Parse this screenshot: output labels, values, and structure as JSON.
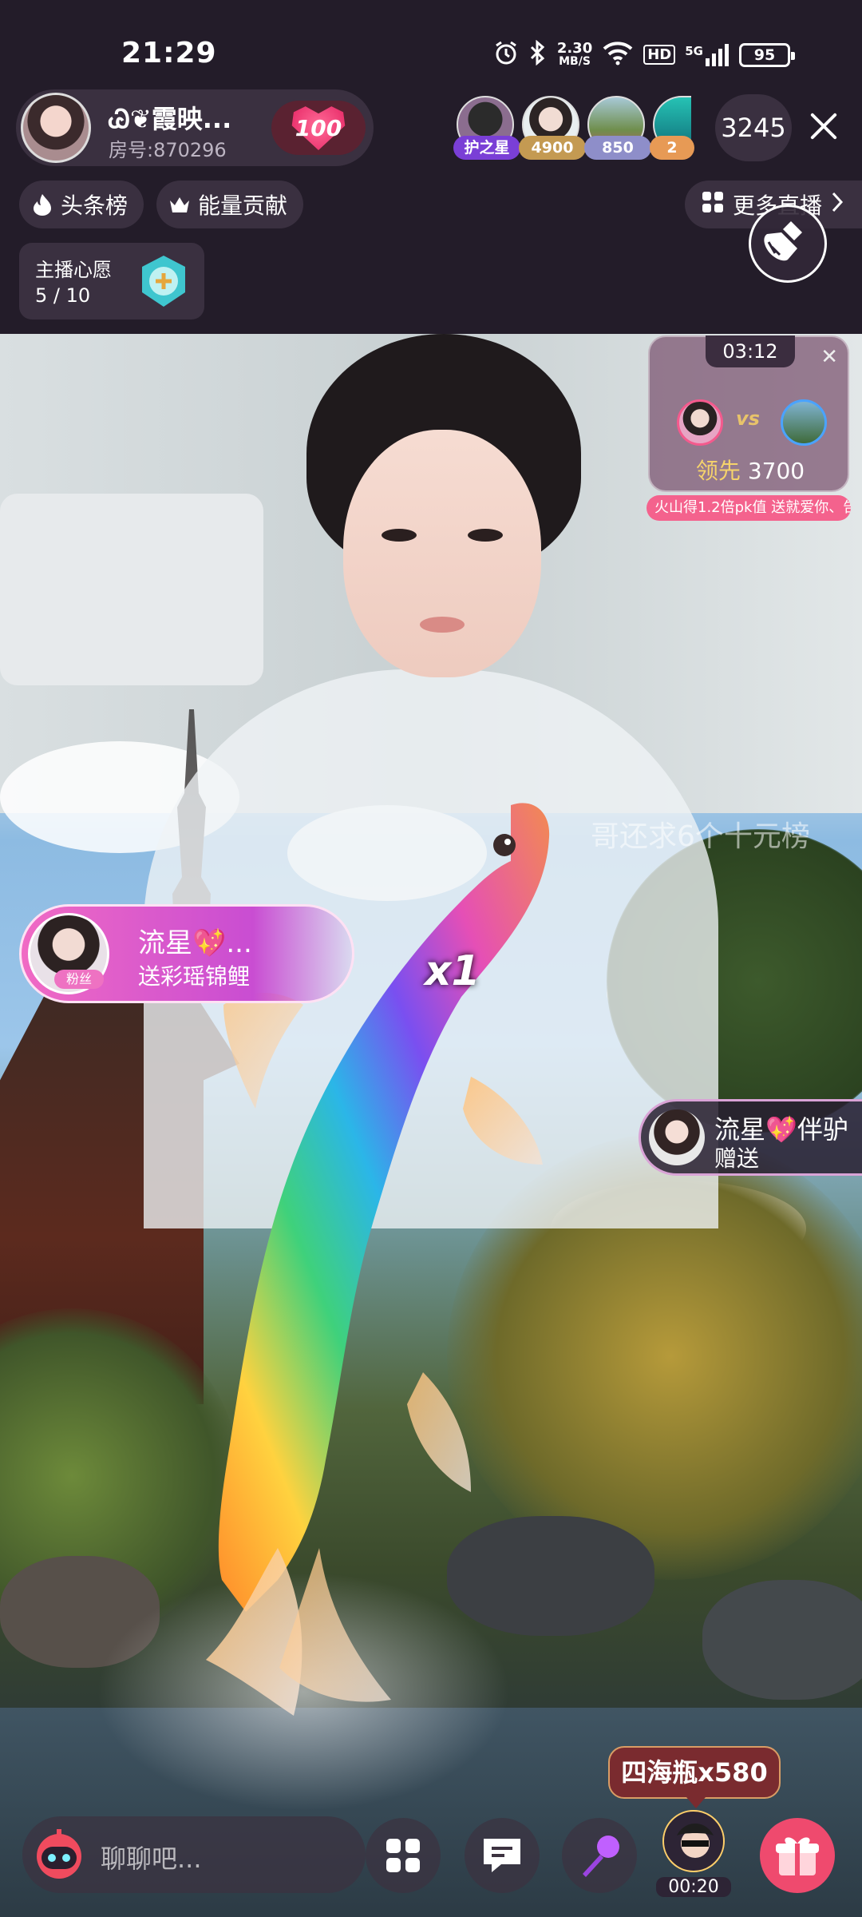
{
  "status_bar": {
    "time": "21:29",
    "net_speed_value": "2.30",
    "net_speed_unit": "MB/S",
    "hd": "HD",
    "network": "5G",
    "battery": "95"
  },
  "header": {
    "host_name": "Ꮚ❦霞映...",
    "room_number": "房号:870296",
    "heart_level": "100",
    "viewers": [
      {
        "tag": "护之星",
        "tag_color": "#7a3fd6"
      },
      {
        "tag": "4900",
        "tag_color": "#c49a52"
      },
      {
        "tag": "850",
        "tag_color": "#8e8ec9"
      },
      {
        "tag": "2",
        "tag_color": "#e79a55"
      }
    ],
    "online_count": "3245",
    "chips": {
      "headline_rank": "头条榜",
      "energy_contribution": "能量贡献",
      "more_live": "更多直播"
    },
    "wish": {
      "title": "主播心愿",
      "progress": "5 / 10",
      "progress_value": 0.5
    }
  },
  "pk": {
    "timer": "03:12",
    "vs": "vs",
    "lead_label": "领先",
    "lead_value": "3700",
    "strip_text": "火山得1.2倍pk值    送就爱你、告"
  },
  "overlay_banner": "哥还求6个十元榜",
  "gift_notifications": {
    "left": {
      "user": "流星💖...",
      "fan_tag": "粉丝",
      "gift_text": "送彩瑶锦鲤",
      "combo": "x1"
    },
    "right": {
      "user": "流星💖伴驴",
      "gift_text": "赠送"
    }
  },
  "bottom_bar": {
    "chat_placeholder": "聊聊吧...",
    "gift_bubble": "四海瓶x580",
    "avatar_timer": "00:20"
  },
  "colors": {
    "background": "#231c29",
    "pill": "#3a3040",
    "heart": "#e21c5d",
    "pk_strip": "#f4628d",
    "gift_button": "#ef4a6e"
  }
}
